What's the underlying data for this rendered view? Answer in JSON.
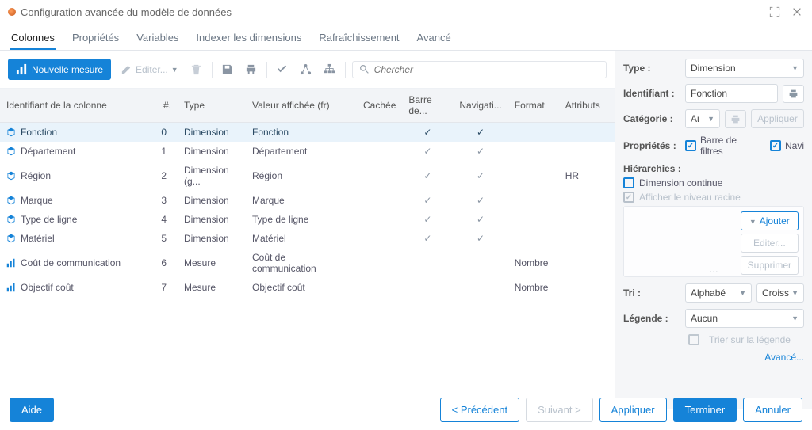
{
  "window": {
    "title": "Configuration avancée du modèle de données"
  },
  "tabs": [
    "Colonnes",
    "Propriétés",
    "Variables",
    "Indexer les dimensions",
    "Rafraîchissement",
    "Avancé"
  ],
  "activeTab": 0,
  "toolbar": {
    "newMeasure": "Nouvelle mesure",
    "edit": "Editer...",
    "searchPlaceholder": "Chercher"
  },
  "table": {
    "headers": {
      "id": "Identifiant de la colonne",
      "num": "#.",
      "type": "Type",
      "display": "Valeur affichée (fr)",
      "hidden": "Cachée",
      "filterbar": "Barre de...",
      "nav": "Navigati...",
      "format": "Format",
      "attributes": "Attributs"
    },
    "rows": [
      {
        "icon": "cube",
        "id": "Fonction",
        "num": 0,
        "type": "Dimension",
        "display": "Fonction",
        "bar": true,
        "nav": true,
        "format": "",
        "attr": "",
        "selected": true
      },
      {
        "icon": "cube",
        "id": "Département",
        "num": 1,
        "type": "Dimension",
        "display": "Département",
        "bar": true,
        "nav": true,
        "format": "",
        "attr": ""
      },
      {
        "icon": "cube",
        "id": "Région",
        "num": 2,
        "type": "Dimension (g...",
        "display": "Région",
        "bar": true,
        "nav": true,
        "format": "",
        "attr": "HR"
      },
      {
        "icon": "cube",
        "id": "Marque",
        "num": 3,
        "type": "Dimension",
        "display": "Marque",
        "bar": true,
        "nav": true,
        "format": "",
        "attr": ""
      },
      {
        "icon": "cube",
        "id": "Type de ligne",
        "num": 4,
        "type": "Dimension",
        "display": "Type de ligne",
        "bar": true,
        "nav": true,
        "format": "",
        "attr": ""
      },
      {
        "icon": "cube",
        "id": "Matériel",
        "num": 5,
        "type": "Dimension",
        "display": "Matériel",
        "bar": true,
        "nav": true,
        "format": "",
        "attr": ""
      },
      {
        "icon": "bars",
        "id": "Coût de communication",
        "num": 6,
        "type": "Mesure",
        "display": "Coût de communication",
        "bar": false,
        "nav": false,
        "format": "Nombre",
        "attr": ""
      },
      {
        "icon": "bars",
        "id": "Objectif coût",
        "num": 7,
        "type": "Mesure",
        "display": "Objectif coût",
        "bar": false,
        "nav": false,
        "format": "Nombre",
        "attr": ""
      }
    ]
  },
  "panel": {
    "typeLabel": "Type :",
    "typeValue": "Dimension",
    "idLabel": "Identifiant :",
    "idValue": "Fonction",
    "catLabel": "Catégorie :",
    "catValue": "Aι",
    "applyBtn": "Appliquer",
    "propsLabel": "Propriétés :",
    "propFilterBar": "Barre de filtres",
    "propNav": "Navi",
    "hierLabel": "Hiérarchies :",
    "continuousDim": "Dimension continue",
    "showRoot": "Afficher le niveau racine",
    "addBtn": "Ajouter",
    "editBtn": "Editer...",
    "deleteBtn": "Supprimer",
    "sortLabel": "Tri :",
    "sortValue": "Alphabé",
    "sortDir": "Croiss",
    "legendLabel": "Légende :",
    "legendValue": "Aucun",
    "sortOnLegend": "Trier sur la légende",
    "advancedLink": "Avancé..."
  },
  "footer": {
    "help": "Aide",
    "prev": "< Précédent",
    "next": "Suivant >",
    "apply": "Appliquer",
    "finish": "Terminer",
    "cancel": "Annuler"
  }
}
